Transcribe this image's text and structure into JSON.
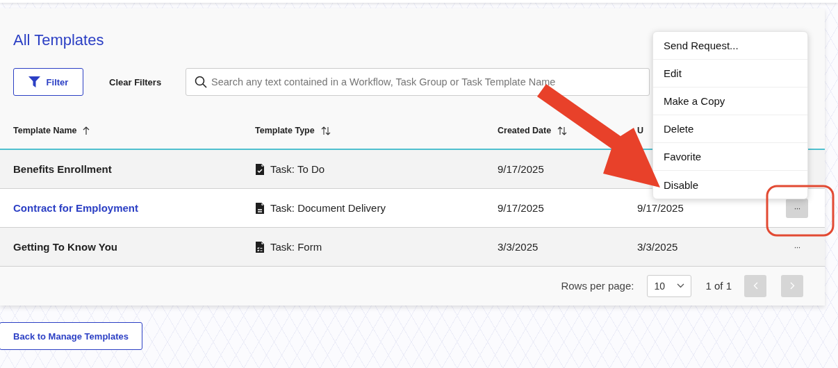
{
  "title": "All Templates",
  "toolbar": {
    "filter_button": "Filter",
    "clear_filters": "Clear Filters",
    "search": {
      "placeholder": "Search any text contained in a Workflow, Task Group or Task Template Name"
    }
  },
  "table": {
    "columns": [
      {
        "label": "Template Name",
        "kind": "ascending"
      },
      {
        "label": "Template Type",
        "kind": "sortable"
      },
      {
        "label": "Created Date",
        "kind": "sortable"
      },
      {
        "label": "U"
      }
    ],
    "rows": [
      {
        "name": "Benefits Enrollment",
        "is_link": false,
        "kind": "todo",
        "type": "Task: To Do",
        "created": "9/17/2025"
      },
      {
        "name": "Contract for Employment",
        "is_link": true,
        "kind": "delivery",
        "type": "Task: Document Delivery",
        "created": "9/17/2025",
        "column_4": "9/17/2025",
        "actions": "···",
        "actions_active": true
      },
      {
        "name": "Getting To Know You",
        "is_link": false,
        "kind": "form",
        "type": "Task: Form",
        "created": "3/3/2025",
        "column_4": "3/3/2025",
        "actions": "···",
        "actions_active": false
      }
    ]
  },
  "pagination": {
    "rows_per_page_label": "Rows per page:",
    "rows_per_page": "10",
    "page_info": "1 of 1",
    "prev_disabled": true,
    "next_disabled": true
  },
  "menu": {
    "items": [
      {
        "label": "Send Request..."
      },
      {
        "label": "Edit"
      },
      {
        "label": "Make a Copy"
      },
      {
        "label": "Delete"
      },
      {
        "label": "Favorite"
      },
      {
        "label": "Disable"
      }
    ]
  },
  "back_button": "Back to Manage Templates"
}
